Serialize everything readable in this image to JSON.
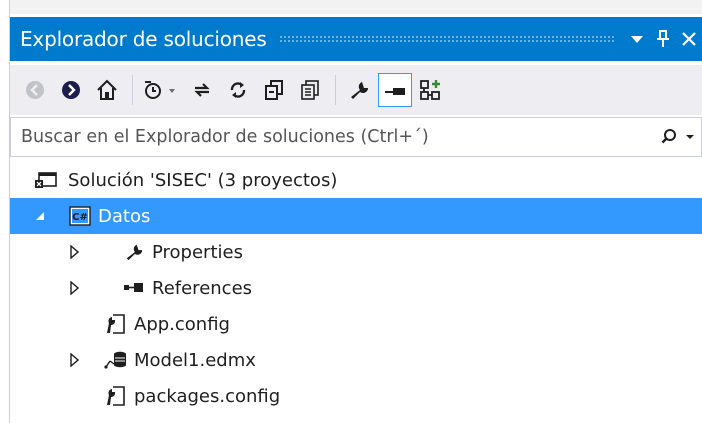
{
  "panel": {
    "title": "Explorador de soluciones",
    "title_buttons": {
      "dropdown": "▼",
      "pin": "ᛘ",
      "close": "✕"
    }
  },
  "toolbar": {
    "icons": [
      "back-icon",
      "forward-icon",
      "home-icon",
      "pending-changes-icon",
      "sync-icon",
      "refresh-icon",
      "collapse-all-icon",
      "show-all-files-icon",
      "properties-icon",
      "preview-selected-icon",
      "class-view-icon"
    ]
  },
  "search": {
    "placeholder": "Buscar en el Explorador de soluciones (Ctrl+´)",
    "value": ""
  },
  "tree": {
    "solution": {
      "label": "Solución 'SISEC'  (3 proyectos)"
    },
    "project": {
      "label": "Datos",
      "expanded": true,
      "selected": true
    },
    "items": [
      {
        "label": "Properties",
        "icon": "wrench-icon",
        "expandable": true
      },
      {
        "label": "References",
        "icon": "references-icon",
        "expandable": true
      },
      {
        "label": "App.config",
        "icon": "config-file-icon",
        "expandable": false
      },
      {
        "label": "Model1.edmx",
        "icon": "edmx-icon",
        "expandable": true
      },
      {
        "label": "packages.config",
        "icon": "config-file-icon",
        "expandable": false
      }
    ]
  },
  "colors": {
    "accent": "#007acc",
    "selection": "#3399ff",
    "toolbar_bg": "#eeeef2"
  }
}
